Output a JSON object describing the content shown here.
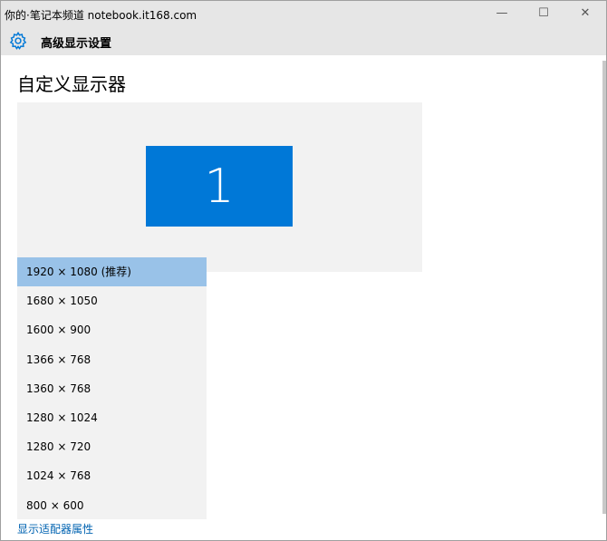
{
  "watermark": "你的·笔记本频道 notebook.it168.com",
  "window": {
    "minimize_glyph": "—",
    "maximize_glyph": "☐",
    "close_glyph": "✕"
  },
  "app": {
    "title": "高级显示设置",
    "icon": "gear-icon"
  },
  "page": {
    "title": "自定义显示器"
  },
  "monitor": {
    "number": "1",
    "color": "#0078d7"
  },
  "resolutions": {
    "selected_index": 0,
    "options": [
      "1920 × 1080 (推荐)",
      "1680 × 1050",
      "1600 × 900",
      "1366 × 768",
      "1360 × 768",
      "1280 × 1024",
      "1280 × 720",
      "1024 × 768",
      "800 × 600"
    ]
  },
  "link": {
    "label": "显示适配器属性"
  },
  "colors": {
    "accent": "#0078d7",
    "selected": "#99c2e8",
    "link": "#0063b1"
  }
}
